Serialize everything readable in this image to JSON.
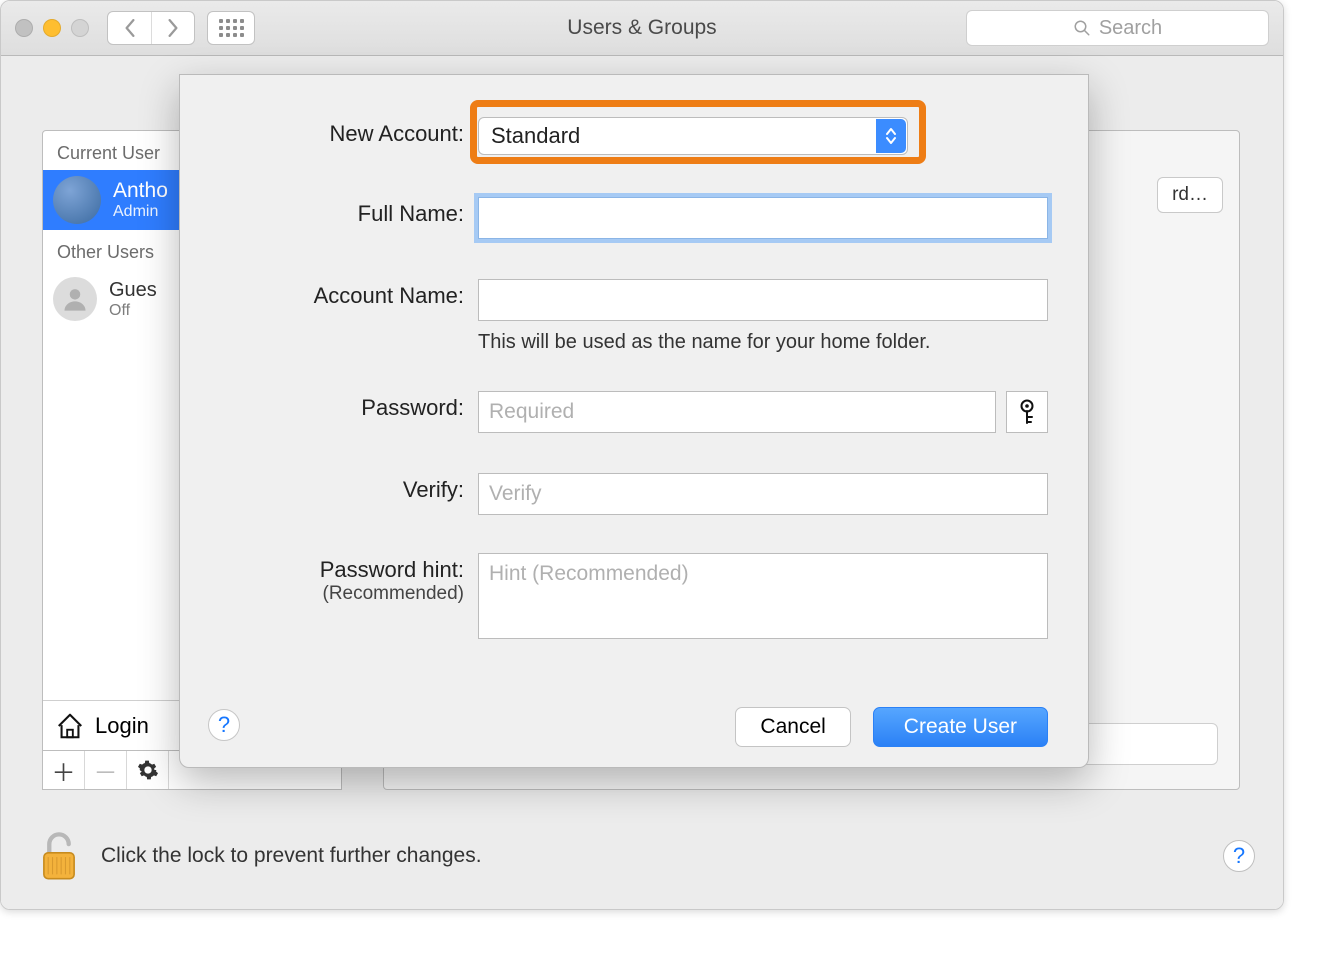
{
  "window": {
    "title": "Users & Groups",
    "search_placeholder": "Search"
  },
  "sidebar": {
    "current_header": "Current User",
    "other_header": "Other Users",
    "current": {
      "name": "Antho",
      "role": "Admin"
    },
    "guest": {
      "name": "Gues",
      "role": "Off"
    },
    "login_options": "Login"
  },
  "right_panel": {
    "change_password": "rd…"
  },
  "footer": {
    "lock_text": "Click the lock to prevent further changes.",
    "help": "?"
  },
  "sheet": {
    "labels": {
      "new_account": "New Account:",
      "full_name": "Full Name:",
      "account_name": "Account Name:",
      "account_name_hint": "This will be used as the name for your home folder.",
      "password": "Password:",
      "verify": "Verify:",
      "hint_line1": "Password hint:",
      "hint_line2": "(Recommended)"
    },
    "placeholders": {
      "password": "Required",
      "verify": "Verify",
      "hint": "Hint (Recommended)"
    },
    "account_type": "Standard",
    "buttons": {
      "cancel": "Cancel",
      "create": "Create User",
      "help": "?"
    }
  }
}
